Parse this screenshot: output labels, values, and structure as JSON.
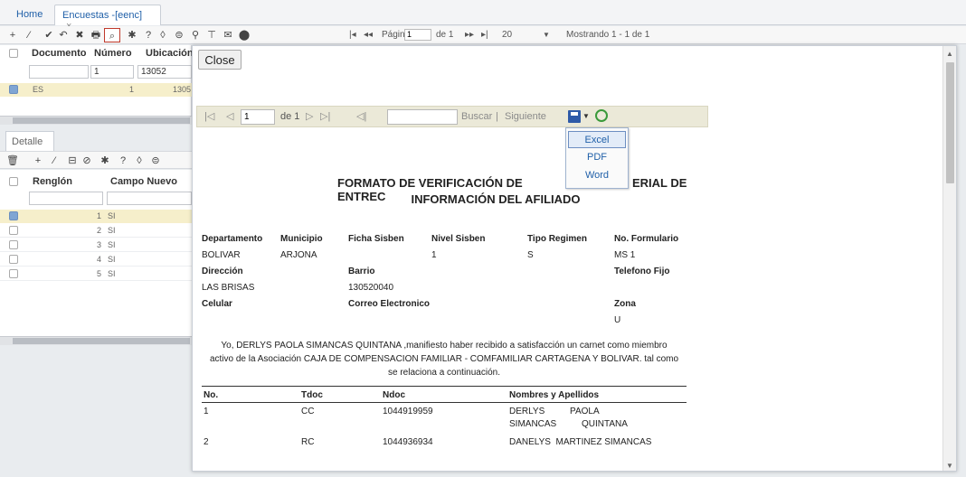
{
  "tabs": {
    "home": "Home",
    "active": "Encuestas -[eenc]",
    "close": "×"
  },
  "toolbar": {
    "icons": [
      "+",
      "⁄",
      "✔",
      "↶",
      "✖",
      "🖶",
      "⌕",
      "✱",
      "?",
      "◊",
      "⊜",
      "⚲",
      "⊤",
      "✉",
      "⬤"
    ],
    "pager_first": "|◂",
    "pager_prev": "◂◂",
    "page_label": "Página",
    "page_value": "1",
    "page_of": "de 1",
    "pager_next": "▸▸",
    "pager_last": "▸|",
    "page_size": "20",
    "page_size_arrow": "▼",
    "showing": "Mostrando 1 - 1 de 1"
  },
  "top_grid": {
    "headers": [
      "Documento",
      "Número",
      "Ubicación"
    ],
    "filters": [
      "",
      "1",
      "13052"
    ],
    "row": {
      "documento": "ES",
      "numero": "1",
      "ubicacion": "1305"
    }
  },
  "detalle": {
    "tab": "Detalle",
    "icons": [
      "🗑",
      "+",
      "⁄",
      "⊟",
      "⊘",
      "✱",
      "?",
      "◊",
      "⊜"
    ],
    "headers": [
      "Renglón",
      "Campo Nuevo"
    ],
    "rows": [
      {
        "n": "1",
        "v": "SI"
      },
      {
        "n": "2",
        "v": "SI"
      },
      {
        "n": "3",
        "v": "SI"
      },
      {
        "n": "4",
        "v": "SI"
      },
      {
        "n": "5",
        "v": "SI"
      }
    ]
  },
  "modal": {
    "close_label": "Close",
    "report_toolbar": {
      "first": "|◁",
      "prev": "◁",
      "page_value": "1",
      "of": "de 1",
      "next": "▷",
      "last": "▷|",
      "back": "◁|",
      "find_label": "Buscar",
      "sep": "|",
      "next_label": "Siguiente"
    },
    "export_menu": [
      "Excel",
      "PDF",
      "Word"
    ],
    "report": {
      "title_line1": "FORMATO DE VERIFICACIÓN DE ENTREC",
      "title_line1_tail": "ERIAL DE",
      "title_line2": "INFORMACIÓN DEL AFILIADO",
      "labels": {
        "departamento": "Departamento",
        "municipio": "Municipio",
        "ficha": "Ficha Sisben",
        "nivel": "Nivel Sisben",
        "regimen": "Tipo Regimen",
        "formulario": "No. Formulario",
        "direccion": "Dirección",
        "barrio": "Barrio",
        "telefono": "Telefono Fijo",
        "celular": "Celular",
        "correo": "Correo Electronico",
        "zona": "Zona"
      },
      "values": {
        "departamento": "BOLIVAR",
        "municipio": "ARJONA",
        "nivel": "1",
        "regimen": "S",
        "formulario": "MS  1",
        "direccion": "LAS BRISAS",
        "barrio": "130520040",
        "zona": "U"
      },
      "paragraph": [
        "Yo, DERLYS PAOLA SIMANCAS QUINTANA ,manifiesto haber recibido a satisfacción un carnet como miembro",
        "activo de la Asociación CAJA DE COMPENSACION FAMILIAR - COMFAMILIAR CARTAGENA Y BOLIVAR. tal como",
        "se relaciona a continuación."
      ],
      "table_headers": [
        "No.",
        "Tdoc",
        "Ndoc",
        "Nombres y Apellidos"
      ],
      "table_rows": [
        {
          "no": "1",
          "tdoc": "CC",
          "ndoc": "1044919959",
          "name1": "DERLYS          PAOLA",
          "name2": "SIMANCAS          QUINTANA"
        },
        {
          "no": "2",
          "tdoc": "RC",
          "ndoc": "1044936934",
          "name1": "DANELYS  MARTINEZ SIMANCAS",
          "name2": ""
        }
      ]
    }
  }
}
